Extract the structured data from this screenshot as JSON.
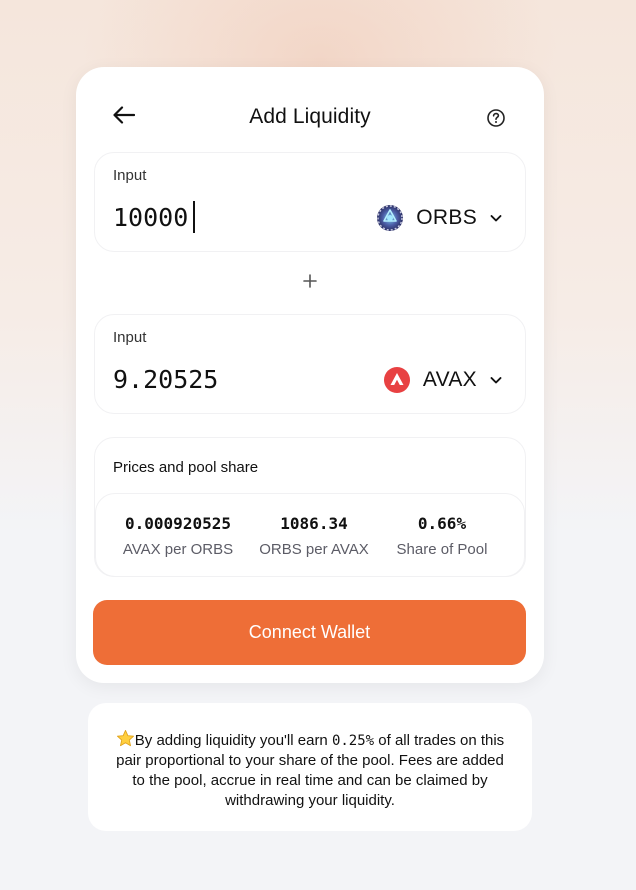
{
  "header": {
    "title": "Add Liquidity"
  },
  "inputs": [
    {
      "label": "Input",
      "value": "10000",
      "token": {
        "symbol": "ORBS",
        "icon": "orbs-token-icon"
      }
    },
    {
      "label": "Input",
      "value": "9.20525",
      "token": {
        "symbol": "AVAX",
        "icon": "avax-token-icon"
      }
    }
  ],
  "pool": {
    "title": "Prices and pool share",
    "stats": [
      {
        "value": "0.000920525",
        "label": "AVAX per ORBS"
      },
      {
        "value": "1086.34",
        "label": "ORBS per AVAX"
      },
      {
        "value": "0.66%",
        "label": "Share of Pool"
      }
    ]
  },
  "action": {
    "connect_label": "Connect Wallet"
  },
  "info": {
    "part1": "By adding liquidity you'll earn ",
    "fee": "0.25%",
    "part2": " of all trades on this pair proportional to your share of the pool. Fees are added to the pool, accrue in real time and can be claimed by withdrawing your liquidity."
  },
  "colors": {
    "accent": "#ee6e37",
    "avax": "#e84142"
  }
}
